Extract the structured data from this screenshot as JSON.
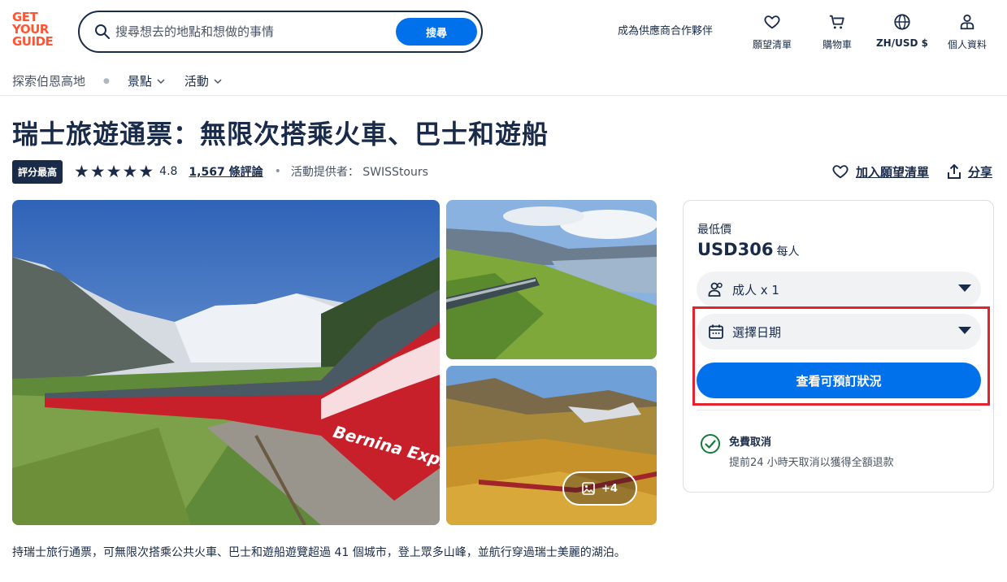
{
  "header": {
    "logo_lines": [
      "GET",
      "YOUR",
      "GUIDE"
    ],
    "search_placeholder": "搜尋想去的地點和想做的事情",
    "search_button": "搜尋",
    "supplier_link": "成為供應商合作夥伴",
    "nav": [
      {
        "icon": "heart-icon",
        "label": "願望清單"
      },
      {
        "icon": "cart-icon",
        "label": "購物車"
      },
      {
        "icon": "globe-icon",
        "label": "ZH/USD $"
      },
      {
        "icon": "profile-icon",
        "label": "個人資料"
      }
    ]
  },
  "subnav": {
    "explore": "探索伯恩高地",
    "attractions": "景點",
    "activities": "活動"
  },
  "activity": {
    "title": "瑞士旅遊通票：無限次搭乘火車、巴士和遊船",
    "badge": "評分最高",
    "stars": "★★★★★",
    "rating": "4.8",
    "reviews": "1,567 條評論",
    "dot": "•",
    "provider": "活動提供者： SWISStours",
    "wishlist_action": "加入願望清單",
    "share_action": "分享",
    "more_photos": "+4",
    "description": "持瑞士旅行通票，可無限次搭乘公共火車、巴士和遊船遊覽超過 41 個城市，登上眾多山峰，並航行穿過瑞士美麗的湖泊。"
  },
  "booking": {
    "from_label": "最低價",
    "price": "USD306",
    "per": "每人",
    "participants": "成人 x 1",
    "date": "選擇日期",
    "check_button": "查看可預訂狀況",
    "cancel_title": "免費取消",
    "cancel_desc": "提前24 小時天取消以獲得全額退款"
  },
  "colors": {
    "brand": "#ff5533",
    "primary": "#0071eb",
    "text": "#1a2b49",
    "highlight": "#e5232f"
  }
}
